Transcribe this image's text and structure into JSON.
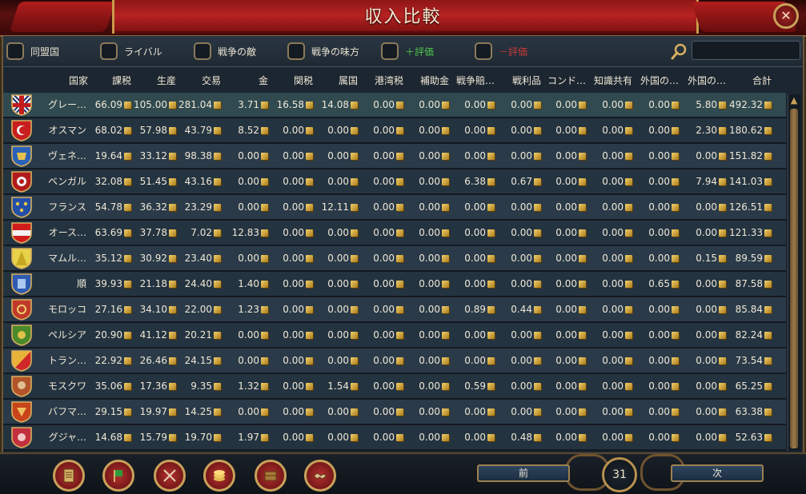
{
  "window": {
    "title": "収入比較"
  },
  "filters": [
    {
      "label": "同盟国",
      "style": "normal"
    },
    {
      "label": "ライバル",
      "style": "normal"
    },
    {
      "label": "戦争の敵",
      "style": "normal"
    },
    {
      "label": "戦争の味方",
      "style": "normal"
    },
    {
      "label": "＋評価",
      "style": "plus"
    },
    {
      "label": "－評価",
      "style": "minus"
    }
  ],
  "search": {
    "value": "",
    "placeholder": ""
  },
  "columns": [
    "国家",
    "課税",
    "生産",
    "交易",
    "金",
    "関税",
    "属国",
    "港湾税",
    "補助金",
    "戦争賠…",
    "戦利品",
    "コンド…",
    "知識共有",
    "外国の…",
    "外国の…",
    "合計"
  ],
  "rows": [
    {
      "country": "グレー…",
      "flag": "england",
      "values": [
        "66.09",
        "105.00",
        "281.04",
        "3.71",
        "16.58",
        "14.08",
        "0.00",
        "0.00",
        "0.00",
        "0.00",
        "0.00",
        "0.00",
        "0.00",
        "5.80",
        "492.32"
      ]
    },
    {
      "country": "オスマン",
      "flag": "ottoman",
      "values": [
        "68.02",
        "57.98",
        "43.79",
        "8.52",
        "0.00",
        "0.00",
        "0.00",
        "0.00",
        "0.00",
        "0.00",
        "0.00",
        "0.00",
        "0.00",
        "2.30",
        "180.62"
      ]
    },
    {
      "country": "ヴェネ…",
      "flag": "venice",
      "values": [
        "19.64",
        "33.12",
        "98.38",
        "0.00",
        "0.00",
        "0.00",
        "0.00",
        "0.00",
        "0.00",
        "0.00",
        "0.00",
        "0.00",
        "0.00",
        "0.00",
        "151.82"
      ]
    },
    {
      "country": "ベンガル",
      "flag": "bengal",
      "values": [
        "32.08",
        "51.45",
        "43.16",
        "0.00",
        "0.00",
        "0.00",
        "0.00",
        "0.00",
        "6.38",
        "0.67",
        "0.00",
        "0.00",
        "0.00",
        "7.94",
        "141.03"
      ]
    },
    {
      "country": "フランス",
      "flag": "france",
      "values": [
        "54.78",
        "36.32",
        "23.29",
        "0.00",
        "0.00",
        "12.11",
        "0.00",
        "0.00",
        "0.00",
        "0.00",
        "0.00",
        "0.00",
        "0.00",
        "0.00",
        "126.51"
      ]
    },
    {
      "country": "オース…",
      "flag": "austria",
      "values": [
        "63.69",
        "37.78",
        "7.02",
        "12.83",
        "0.00",
        "0.00",
        "0.00",
        "0.00",
        "0.00",
        "0.00",
        "0.00",
        "0.00",
        "0.00",
        "0.00",
        "121.33"
      ]
    },
    {
      "country": "マムル…",
      "flag": "mamluks",
      "values": [
        "35.12",
        "30.92",
        "23.40",
        "0.00",
        "0.00",
        "0.00",
        "0.00",
        "0.00",
        "0.00",
        "0.00",
        "0.00",
        "0.00",
        "0.00",
        "0.15",
        "89.59"
      ]
    },
    {
      "country": "順",
      "flag": "shun",
      "values": [
        "39.93",
        "21.18",
        "24.40",
        "1.40",
        "0.00",
        "0.00",
        "0.00",
        "0.00",
        "0.00",
        "0.00",
        "0.00",
        "0.00",
        "0.65",
        "0.00",
        "87.58"
      ]
    },
    {
      "country": "モロッコ",
      "flag": "morocco",
      "values": [
        "27.16",
        "34.10",
        "22.00",
        "1.23",
        "0.00",
        "0.00",
        "0.00",
        "0.00",
        "0.89",
        "0.44",
        "0.00",
        "0.00",
        "0.00",
        "0.00",
        "85.84"
      ]
    },
    {
      "country": "ペルシア",
      "flag": "persia",
      "values": [
        "20.90",
        "41.12",
        "20.21",
        "0.00",
        "0.00",
        "0.00",
        "0.00",
        "0.00",
        "0.00",
        "0.00",
        "0.00",
        "0.00",
        "0.00",
        "0.00",
        "82.24"
      ]
    },
    {
      "country": "トラン…",
      "flag": "transoxiana",
      "values": [
        "22.92",
        "26.46",
        "24.15",
        "0.00",
        "0.00",
        "0.00",
        "0.00",
        "0.00",
        "0.00",
        "0.00",
        "0.00",
        "0.00",
        "0.00",
        "0.00",
        "73.54"
      ]
    },
    {
      "country": "モスクワ",
      "flag": "muscovy",
      "values": [
        "35.06",
        "17.36",
        "9.35",
        "1.32",
        "0.00",
        "1.54",
        "0.00",
        "0.00",
        "0.59",
        "0.00",
        "0.00",
        "0.00",
        "0.00",
        "0.00",
        "65.25"
      ]
    },
    {
      "country": "バフマ…",
      "flag": "bahmanis",
      "values": [
        "29.15",
        "19.97",
        "14.25",
        "0.00",
        "0.00",
        "0.00",
        "0.00",
        "0.00",
        "0.00",
        "0.00",
        "0.00",
        "0.00",
        "0.00",
        "0.00",
        "63.38"
      ]
    },
    {
      "country": "グジャ…",
      "flag": "gujarat",
      "values": [
        "14.68",
        "15.79",
        "19.70",
        "1.97",
        "0.00",
        "0.00",
        "0.00",
        "0.00",
        "0.00",
        "0.48",
        "0.00",
        "0.00",
        "0.00",
        "0.00",
        "52.63"
      ]
    }
  ],
  "pagination": {
    "prev_label": "前",
    "next_label": "次",
    "page": "31"
  },
  "bottom_buttons": [
    {
      "name": "ledger-icon"
    },
    {
      "name": "flag-icon"
    },
    {
      "name": "crossed-swords-icon"
    },
    {
      "name": "coins-icon"
    },
    {
      "name": "crate-icon"
    },
    {
      "name": "handshake-icon"
    }
  ],
  "colors": {
    "accent_red": "#b72222",
    "gold": "#c9a15a",
    "positive": "#4fc24f",
    "negative": "#c83a3a"
  }
}
